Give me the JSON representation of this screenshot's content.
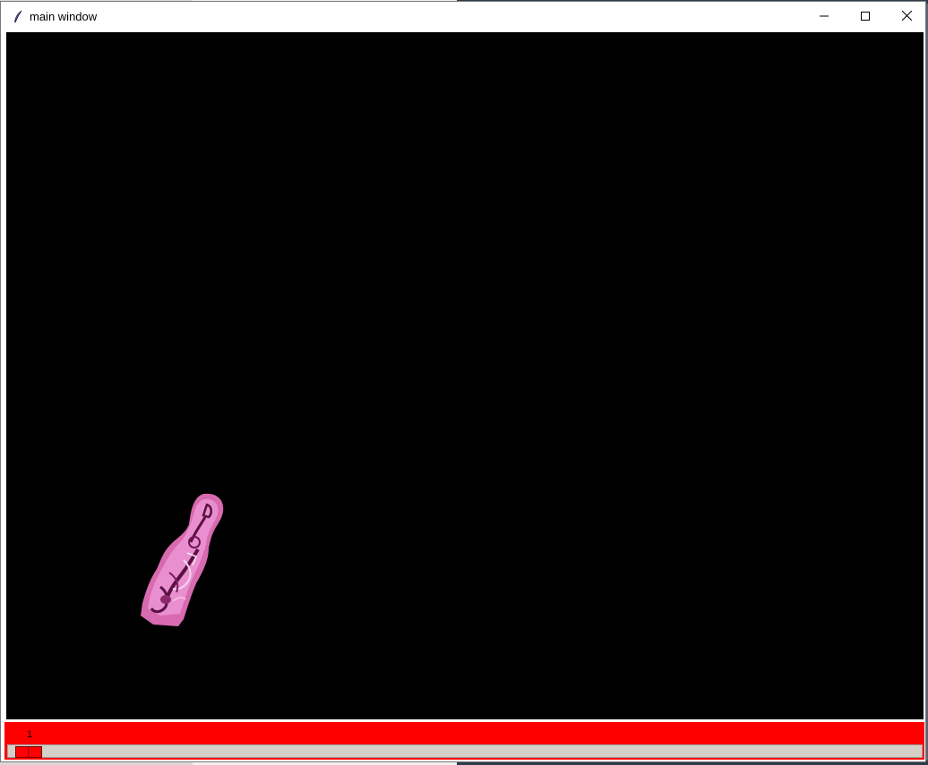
{
  "window": {
    "title": "main window",
    "app_icon": "feather-icon",
    "controls": {
      "minimize_icon": "minimize-icon",
      "maximize_icon": "maximize-icon",
      "close_icon": "close-icon"
    }
  },
  "canvas": {
    "background": "#000000",
    "sprite": "pink-sprite-image"
  },
  "frame_slider": {
    "value_label": "1",
    "value": 1,
    "accent_color": "#ff0000"
  }
}
